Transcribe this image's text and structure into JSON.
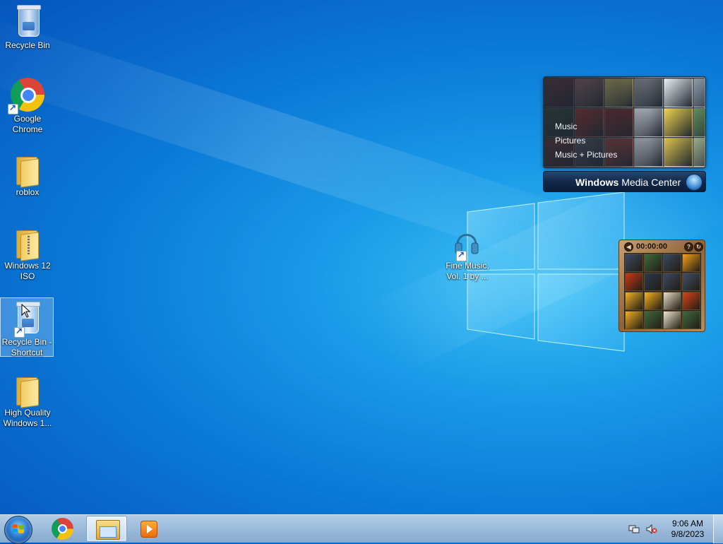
{
  "desktop": {
    "icons": [
      {
        "label": "Recycle Bin",
        "type": "recycle-bin",
        "shortcut": false
      },
      {
        "label": "Google Chrome",
        "type": "chrome",
        "shortcut": true
      },
      {
        "label": "roblox",
        "type": "folder",
        "shortcut": false
      },
      {
        "label": "Windows 12 ISO",
        "type": "zip-folder",
        "shortcut": false
      },
      {
        "label": "Recycle Bin - Shortcut",
        "type": "recycle-bin",
        "shortcut": true,
        "selected": true
      },
      {
        "label": "High Quality Windows 1...",
        "type": "folder",
        "shortcut": false
      },
      {
        "label": "Fine Music, Vol. 1 by ...",
        "type": "music",
        "shortcut": true
      }
    ]
  },
  "media_center_gadget": {
    "menu": [
      "Music",
      "Pictures",
      "Music + Pictures"
    ],
    "brand_bold": "Windows",
    "brand_rest": " Media Center",
    "tile_colors": [
      "#b5473f",
      "#c98a7a",
      "#e0cf6a",
      "#7a7f86",
      "#e9eef2",
      "#8c9aa6",
      "#4f7d3c",
      "#d93b2c",
      "#8f2d29",
      "#c7ccd2",
      "#f0d34a",
      "#5f8a5a",
      "#c54a3a",
      "#6a6f76",
      "#a84638",
      "#aeb4bb",
      "#dcc24d",
      "#9aa98a"
    ]
  },
  "puzzle_gadget": {
    "timer": "00:00:00",
    "tile_colors": [
      "#3a4a63",
      "#3e6b3e",
      "#394a60",
      "#f4a11c",
      "#c83a1a",
      "#2a3a50",
      "#3a4a63",
      "#40506a",
      "#f0b228",
      "#f7b31f",
      "#e9e0c8",
      "#d9441a",
      "#f2b026",
      "#3e6b3e",
      "#eee7cf",
      "#3e6b3e"
    ]
  },
  "taskbar": {
    "pinned": [
      "start-button",
      "chrome",
      "file-explorer",
      "media-player"
    ],
    "active": "file-explorer",
    "clock_time": "9:06 AM",
    "clock_date": "9/8/2023",
    "tray_icons": [
      "network-icon",
      "volume-muted-icon"
    ]
  }
}
